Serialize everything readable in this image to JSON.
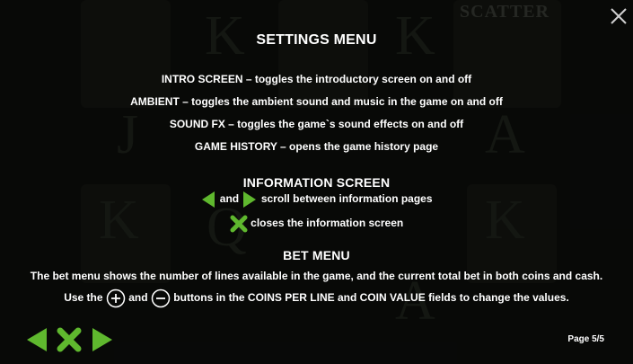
{
  "background": {
    "scatter_label": "SCATTER"
  },
  "header": {
    "title": "SETTINGS MENU"
  },
  "settings": [
    "INTRO SCREEN – toggles the introductory screen on and off",
    "AMBIENT – toggles the ambient sound and music in the game on and off",
    "SOUND FX – toggles the game`s sound effects on and off",
    "GAME HISTORY – opens the game history page"
  ],
  "information": {
    "title": "INFORMATION SCREEN",
    "and_word": "and",
    "scroll_text": "scroll between information pages",
    "close_text": "closes the information screen"
  },
  "bet": {
    "title": "BET MENU",
    "desc": "The bet menu shows the number of lines available in the game, and the current total bet in both coins and cash.",
    "use_the": "Use the",
    "and_word": "and",
    "buttons_text": "buttons in the COINS PER LINE and COIN VALUE fields to change the values."
  },
  "footer": {
    "page": "Page 5/5"
  },
  "colors": {
    "accent_green": "#5fb82e",
    "text": "#ffffff",
    "background": "#0d0e0c"
  },
  "icons": [
    "close-icon",
    "left-arrow-icon",
    "right-arrow-icon",
    "x-icon",
    "plus-icon",
    "minus-icon"
  ]
}
